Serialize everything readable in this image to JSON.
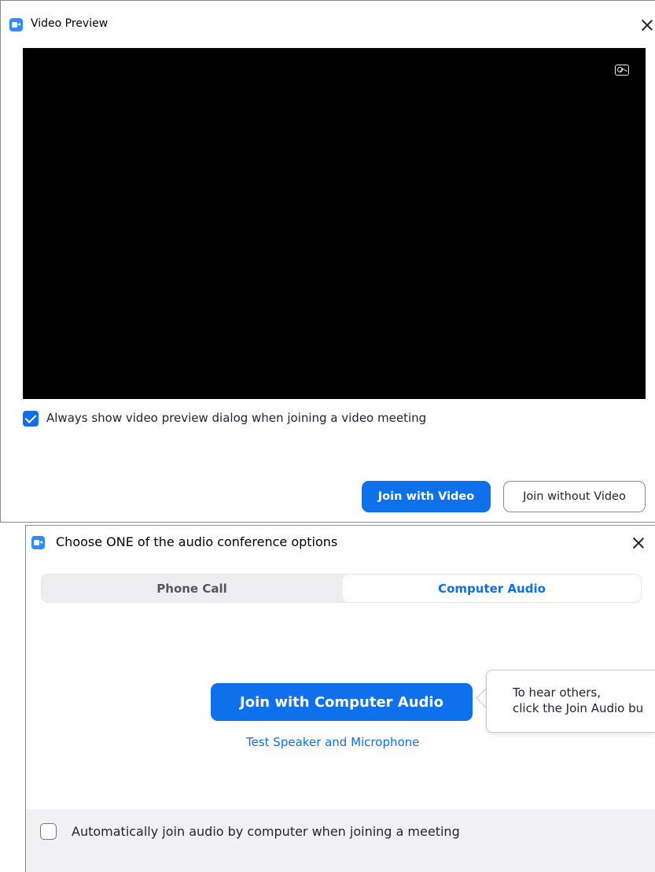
{
  "video_preview": {
    "title": "Video Preview",
    "always_show_label": "Always show video preview dialog when joining a video meeting",
    "always_show_checked": true,
    "join_with_video_label": "Join with Video",
    "join_without_video_label": "Join without Video",
    "icons": [
      "zoom-app-icon",
      "close-icon",
      "background-icon",
      "checkbox-checked-icon"
    ]
  },
  "audio_dialog": {
    "title": "Choose ONE of the audio conference options",
    "tabs": [
      {
        "label": "Phone Call",
        "active": false
      },
      {
        "label": "Computer Audio",
        "active": true
      }
    ],
    "join_audio_label": "Join with Computer Audio",
    "test_link_label": "Test Speaker and Microphone",
    "tooltip_line1": "To hear others,",
    "tooltip_line2": "click the Join Audio bu",
    "auto_join_label": "Automatically join audio by computer when joining a meeting",
    "auto_join_checked": false,
    "icons": [
      "zoom-app-icon",
      "close-icon",
      "checkbox-empty-icon"
    ]
  },
  "colors": {
    "accent": "#0E71EB",
    "brand": "#2D8CFF",
    "video_background": "#000000",
    "tab_bar": "#EEEEF1",
    "footer": "#F1F1F3"
  }
}
